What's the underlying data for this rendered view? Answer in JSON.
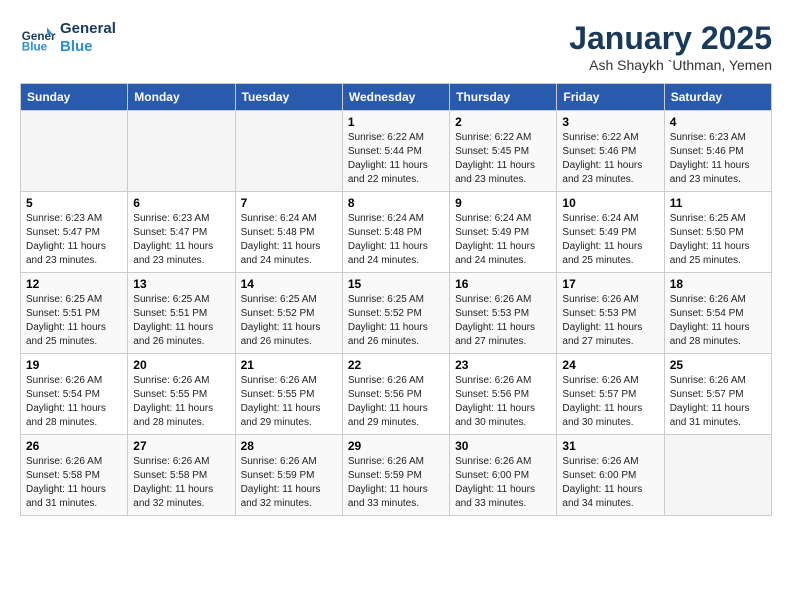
{
  "header": {
    "logo_line1": "General",
    "logo_line2": "Blue",
    "month": "January 2025",
    "location": "Ash Shaykh `Uthman, Yemen"
  },
  "weekdays": [
    "Sunday",
    "Monday",
    "Tuesday",
    "Wednesday",
    "Thursday",
    "Friday",
    "Saturday"
  ],
  "weeks": [
    [
      {
        "day": "",
        "info": ""
      },
      {
        "day": "",
        "info": ""
      },
      {
        "day": "",
        "info": ""
      },
      {
        "day": "1",
        "info": "Sunrise: 6:22 AM\nSunset: 5:44 PM\nDaylight: 11 hours\nand 22 minutes."
      },
      {
        "day": "2",
        "info": "Sunrise: 6:22 AM\nSunset: 5:45 PM\nDaylight: 11 hours\nand 23 minutes."
      },
      {
        "day": "3",
        "info": "Sunrise: 6:22 AM\nSunset: 5:46 PM\nDaylight: 11 hours\nand 23 minutes."
      },
      {
        "day": "4",
        "info": "Sunrise: 6:23 AM\nSunset: 5:46 PM\nDaylight: 11 hours\nand 23 minutes."
      }
    ],
    [
      {
        "day": "5",
        "info": "Sunrise: 6:23 AM\nSunset: 5:47 PM\nDaylight: 11 hours\nand 23 minutes."
      },
      {
        "day": "6",
        "info": "Sunrise: 6:23 AM\nSunset: 5:47 PM\nDaylight: 11 hours\nand 23 minutes."
      },
      {
        "day": "7",
        "info": "Sunrise: 6:24 AM\nSunset: 5:48 PM\nDaylight: 11 hours\nand 24 minutes."
      },
      {
        "day": "8",
        "info": "Sunrise: 6:24 AM\nSunset: 5:48 PM\nDaylight: 11 hours\nand 24 minutes."
      },
      {
        "day": "9",
        "info": "Sunrise: 6:24 AM\nSunset: 5:49 PM\nDaylight: 11 hours\nand 24 minutes."
      },
      {
        "day": "10",
        "info": "Sunrise: 6:24 AM\nSunset: 5:49 PM\nDaylight: 11 hours\nand 25 minutes."
      },
      {
        "day": "11",
        "info": "Sunrise: 6:25 AM\nSunset: 5:50 PM\nDaylight: 11 hours\nand 25 minutes."
      }
    ],
    [
      {
        "day": "12",
        "info": "Sunrise: 6:25 AM\nSunset: 5:51 PM\nDaylight: 11 hours\nand 25 minutes."
      },
      {
        "day": "13",
        "info": "Sunrise: 6:25 AM\nSunset: 5:51 PM\nDaylight: 11 hours\nand 26 minutes."
      },
      {
        "day": "14",
        "info": "Sunrise: 6:25 AM\nSunset: 5:52 PM\nDaylight: 11 hours\nand 26 minutes."
      },
      {
        "day": "15",
        "info": "Sunrise: 6:25 AM\nSunset: 5:52 PM\nDaylight: 11 hours\nand 26 minutes."
      },
      {
        "day": "16",
        "info": "Sunrise: 6:26 AM\nSunset: 5:53 PM\nDaylight: 11 hours\nand 27 minutes."
      },
      {
        "day": "17",
        "info": "Sunrise: 6:26 AM\nSunset: 5:53 PM\nDaylight: 11 hours\nand 27 minutes."
      },
      {
        "day": "18",
        "info": "Sunrise: 6:26 AM\nSunset: 5:54 PM\nDaylight: 11 hours\nand 28 minutes."
      }
    ],
    [
      {
        "day": "19",
        "info": "Sunrise: 6:26 AM\nSunset: 5:54 PM\nDaylight: 11 hours\nand 28 minutes."
      },
      {
        "day": "20",
        "info": "Sunrise: 6:26 AM\nSunset: 5:55 PM\nDaylight: 11 hours\nand 28 minutes."
      },
      {
        "day": "21",
        "info": "Sunrise: 6:26 AM\nSunset: 5:55 PM\nDaylight: 11 hours\nand 29 minutes."
      },
      {
        "day": "22",
        "info": "Sunrise: 6:26 AM\nSunset: 5:56 PM\nDaylight: 11 hours\nand 29 minutes."
      },
      {
        "day": "23",
        "info": "Sunrise: 6:26 AM\nSunset: 5:56 PM\nDaylight: 11 hours\nand 30 minutes."
      },
      {
        "day": "24",
        "info": "Sunrise: 6:26 AM\nSunset: 5:57 PM\nDaylight: 11 hours\nand 30 minutes."
      },
      {
        "day": "25",
        "info": "Sunrise: 6:26 AM\nSunset: 5:57 PM\nDaylight: 11 hours\nand 31 minutes."
      }
    ],
    [
      {
        "day": "26",
        "info": "Sunrise: 6:26 AM\nSunset: 5:58 PM\nDaylight: 11 hours\nand 31 minutes."
      },
      {
        "day": "27",
        "info": "Sunrise: 6:26 AM\nSunset: 5:58 PM\nDaylight: 11 hours\nand 32 minutes."
      },
      {
        "day": "28",
        "info": "Sunrise: 6:26 AM\nSunset: 5:59 PM\nDaylight: 11 hours\nand 32 minutes."
      },
      {
        "day": "29",
        "info": "Sunrise: 6:26 AM\nSunset: 5:59 PM\nDaylight: 11 hours\nand 33 minutes."
      },
      {
        "day": "30",
        "info": "Sunrise: 6:26 AM\nSunset: 6:00 PM\nDaylight: 11 hours\nand 33 minutes."
      },
      {
        "day": "31",
        "info": "Sunrise: 6:26 AM\nSunset: 6:00 PM\nDaylight: 11 hours\nand 34 minutes."
      },
      {
        "day": "",
        "info": ""
      }
    ]
  ]
}
